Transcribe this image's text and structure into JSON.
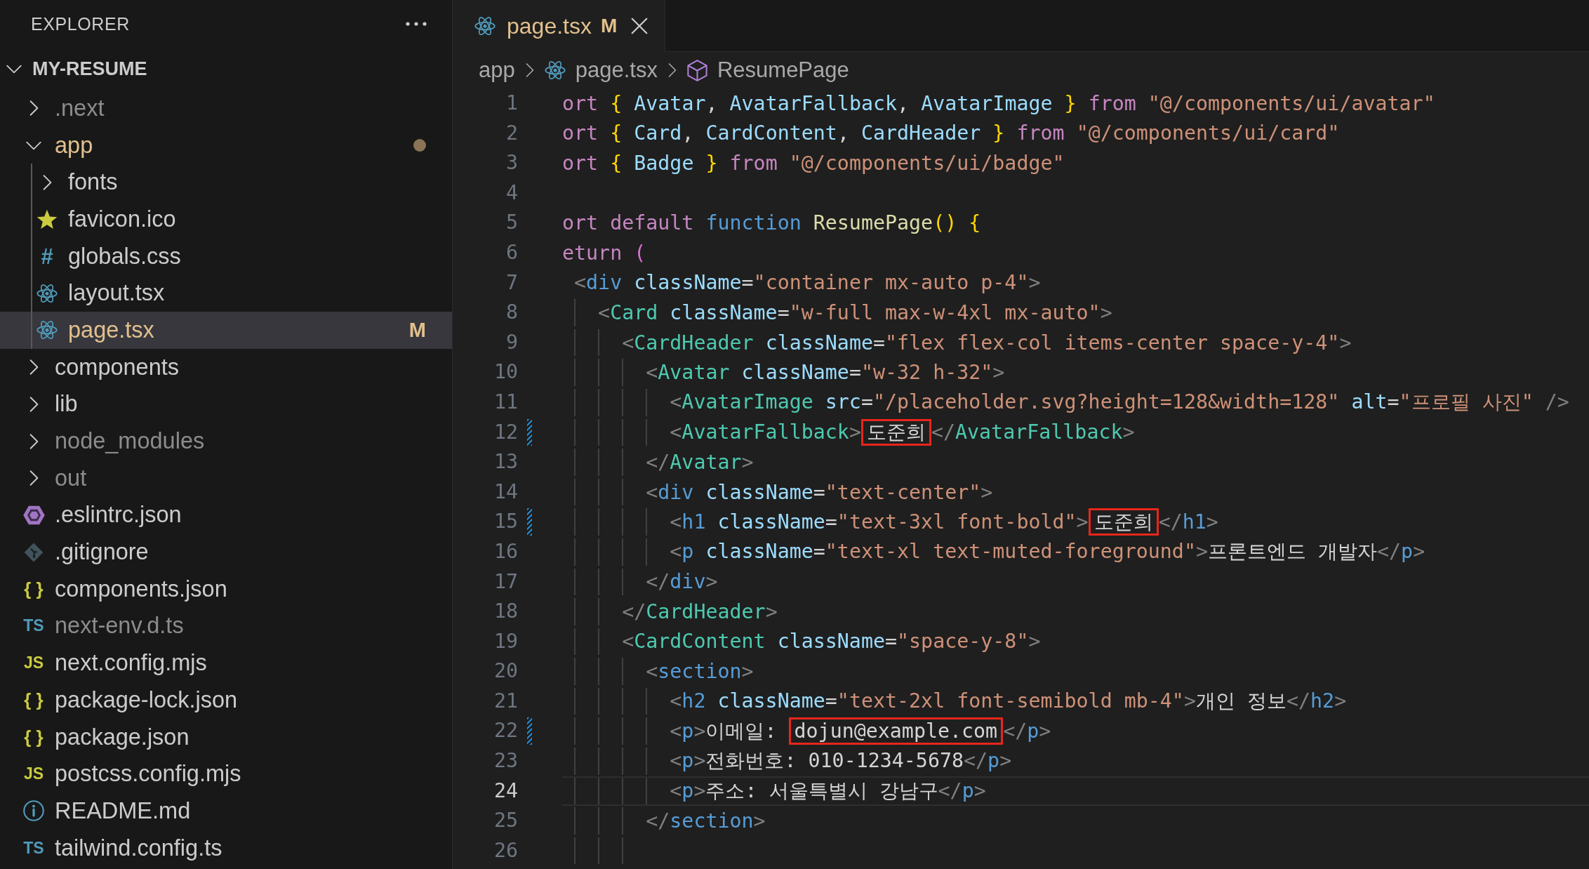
{
  "sidebar": {
    "title": "EXPLORER",
    "root": {
      "name": "MY-RESUME",
      "expanded": true,
      "children": [
        {
          "name": ".next",
          "kind": "folder",
          "expanded": false,
          "selected": false,
          "dimmed": true,
          "modified": false
        },
        {
          "name": "app",
          "kind": "folder",
          "expanded": true,
          "selected": false,
          "dimmed": false,
          "modified": true,
          "children": [
            {
              "name": "fonts",
              "kind": "folder",
              "expanded": false,
              "selected": false,
              "dimmed": false,
              "modified": false
            },
            {
              "name": "favicon.ico",
              "kind": "star",
              "selected": false,
              "dimmed": false,
              "modified": false
            },
            {
              "name": "globals.css",
              "kind": "css",
              "glyph": "#",
              "selected": false,
              "dimmed": false,
              "modified": false
            },
            {
              "name": "layout.tsx",
              "kind": "react",
              "selected": false,
              "dimmed": false,
              "modified": false
            },
            {
              "name": "page.tsx",
              "kind": "react",
              "badge": "M",
              "selected": true,
              "dimmed": false,
              "modified": true
            }
          ]
        },
        {
          "name": "components",
          "kind": "folder",
          "expanded": false,
          "selected": false,
          "dimmed": false,
          "modified": false
        },
        {
          "name": "lib",
          "kind": "folder",
          "expanded": false,
          "selected": false,
          "dimmed": false,
          "modified": false
        },
        {
          "name": "node_modules",
          "kind": "folder",
          "expanded": false,
          "selected": false,
          "dimmed": true,
          "modified": false
        },
        {
          "name": "out",
          "kind": "folder",
          "expanded": false,
          "selected": false,
          "dimmed": true,
          "modified": false
        },
        {
          "name": ".eslintrc.json",
          "kind": "eslint",
          "selected": false,
          "dimmed": false,
          "modified": false
        },
        {
          "name": ".gitignore",
          "kind": "git",
          "selected": false,
          "dimmed": false,
          "modified": false
        },
        {
          "name": "components.json",
          "kind": "json",
          "glyph": "{ }",
          "selected": false,
          "dimmed": false,
          "modified": false
        },
        {
          "name": "next-env.d.ts",
          "kind": "ts",
          "glyph": "TS",
          "selected": false,
          "dimmed": true,
          "modified": false
        },
        {
          "name": "next.config.mjs",
          "kind": "js",
          "glyph": "JS",
          "selected": false,
          "dimmed": false,
          "modified": false
        },
        {
          "name": "package-lock.json",
          "kind": "json",
          "glyph": "{ }",
          "selected": false,
          "dimmed": false,
          "modified": false
        },
        {
          "name": "package.json",
          "kind": "json",
          "glyph": "{ }",
          "selected": false,
          "dimmed": false,
          "modified": false
        },
        {
          "name": "postcss.config.mjs",
          "kind": "js",
          "glyph": "JS",
          "selected": false,
          "dimmed": false,
          "modified": false
        },
        {
          "name": "README.md",
          "kind": "info",
          "selected": false,
          "dimmed": false,
          "modified": false
        },
        {
          "name": "tailwind.config.ts",
          "kind": "ts",
          "glyph": "TS",
          "selected": false,
          "dimmed": false,
          "modified": false
        }
      ]
    }
  },
  "tabs": [
    {
      "label": "page.tsx",
      "kind": "react",
      "badge": "M",
      "modified": true,
      "selected": true
    }
  ],
  "breadcrumbs": [
    {
      "label": "app",
      "kind": "folder"
    },
    {
      "label": "page.tsx",
      "kind": "react"
    },
    {
      "label": "ResumePage",
      "kind": "symbol"
    }
  ],
  "editor": {
    "lines": [
      {
        "number": "1",
        "current": false,
        "modified": false,
        "tokens": [
          {
            "kind": "keyword",
            "text": "ort "
          },
          {
            "kind": "bracket",
            "text": "{ "
          },
          {
            "kind": "variable",
            "text": "Avatar"
          },
          {
            "kind": "plain",
            "text": ", "
          },
          {
            "kind": "variable",
            "text": "AvatarFallback"
          },
          {
            "kind": "plain",
            "text": ", "
          },
          {
            "kind": "variable",
            "text": "AvatarImage "
          },
          {
            "kind": "bracket",
            "text": "} "
          },
          {
            "kind": "keyword",
            "text": "from "
          },
          {
            "kind": "string",
            "text": "\"@/components/ui/avatar\""
          }
        ]
      },
      {
        "number": "2",
        "current": false,
        "modified": false,
        "tokens": [
          {
            "kind": "keyword",
            "text": "ort "
          },
          {
            "kind": "bracket",
            "text": "{ "
          },
          {
            "kind": "variable",
            "text": "Card"
          },
          {
            "kind": "plain",
            "text": ", "
          },
          {
            "kind": "variable",
            "text": "CardContent"
          },
          {
            "kind": "plain",
            "text": ", "
          },
          {
            "kind": "variable",
            "text": "CardHeader "
          },
          {
            "kind": "bracket",
            "text": "} "
          },
          {
            "kind": "keyword",
            "text": "from "
          },
          {
            "kind": "string",
            "text": "\"@/components/ui/card\""
          }
        ]
      },
      {
        "number": "3",
        "current": false,
        "modified": false,
        "tokens": [
          {
            "kind": "keyword",
            "text": "ort "
          },
          {
            "kind": "bracket",
            "text": "{ "
          },
          {
            "kind": "variable",
            "text": "Badge "
          },
          {
            "kind": "bracket",
            "text": "} "
          },
          {
            "kind": "keyword",
            "text": "from "
          },
          {
            "kind": "string",
            "text": "\"@/components/ui/badge\""
          }
        ]
      },
      {
        "number": "4",
        "current": false,
        "modified": false
      },
      {
        "number": "5",
        "current": false,
        "modified": false,
        "tokens": [
          {
            "kind": "keyword",
            "text": "ort default "
          },
          {
            "kind": "storage",
            "text": "function "
          },
          {
            "kind": "function",
            "text": "ResumePage"
          },
          {
            "kind": "bracket",
            "text": "() {"
          }
        ]
      },
      {
        "number": "6",
        "current": false,
        "modified": false,
        "tokens": [
          {
            "kind": "keyword",
            "text": "eturn "
          },
          {
            "kind": "bracket2",
            "text": "("
          }
        ]
      },
      {
        "number": "7",
        "current": false,
        "modified": false,
        "tokens": [
          {
            "kind": "punct",
            "text": " <"
          },
          {
            "kind": "tag",
            "text": "div "
          },
          {
            "kind": "attribute",
            "text": "className"
          },
          {
            "kind": "plain",
            "text": "="
          },
          {
            "kind": "string",
            "text": "\"container mx-auto p-4\""
          },
          {
            "kind": "punct",
            "text": ">"
          }
        ]
      },
      {
        "number": "8",
        "current": false,
        "modified": false,
        "tokens": [
          {
            "kind": "punct",
            "text": "   <"
          },
          {
            "kind": "component",
            "text": "Card "
          },
          {
            "kind": "attribute",
            "text": "className"
          },
          {
            "kind": "plain",
            "text": "="
          },
          {
            "kind": "string",
            "text": "\"w-full max-w-4xl mx-auto\""
          },
          {
            "kind": "punct",
            "text": ">"
          }
        ]
      },
      {
        "number": "9",
        "current": false,
        "modified": false,
        "tokens": [
          {
            "kind": "punct",
            "text": "     <"
          },
          {
            "kind": "component",
            "text": "CardHeader "
          },
          {
            "kind": "attribute",
            "text": "className"
          },
          {
            "kind": "plain",
            "text": "="
          },
          {
            "kind": "string",
            "text": "\"flex flex-col items-center space-y-4\""
          },
          {
            "kind": "punct",
            "text": ">"
          }
        ]
      },
      {
        "number": "10",
        "current": false,
        "modified": false,
        "tokens": [
          {
            "kind": "punct",
            "text": "       <"
          },
          {
            "kind": "component",
            "text": "Avatar "
          },
          {
            "kind": "attribute",
            "text": "className"
          },
          {
            "kind": "plain",
            "text": "="
          },
          {
            "kind": "string",
            "text": "\"w-32 h-32\""
          },
          {
            "kind": "punct",
            "text": ">"
          }
        ]
      },
      {
        "number": "11",
        "current": false,
        "modified": false,
        "tokens": [
          {
            "kind": "punct",
            "text": "         <"
          },
          {
            "kind": "component",
            "text": "AvatarImage "
          },
          {
            "kind": "attribute",
            "text": "src"
          },
          {
            "kind": "plain",
            "text": "="
          },
          {
            "kind": "string",
            "text": "\"/placeholder.svg?height=128&width=128\" "
          },
          {
            "kind": "attribute",
            "text": "alt"
          },
          {
            "kind": "plain",
            "text": "="
          },
          {
            "kind": "string",
            "text": "\"프로필 사진\" "
          },
          {
            "kind": "punct",
            "text": "/>"
          }
        ]
      },
      {
        "number": "12",
        "current": false,
        "modified": true,
        "tokens": [
          {
            "kind": "punct",
            "text": "         <"
          },
          {
            "kind": "component",
            "text": "AvatarFallback"
          },
          {
            "kind": "punct",
            "text": ">"
          },
          {
            "kind": "boxed",
            "text": "도준희"
          },
          {
            "kind": "punct",
            "text": "</"
          },
          {
            "kind": "component",
            "text": "AvatarFallback"
          },
          {
            "kind": "punct",
            "text": ">"
          }
        ]
      },
      {
        "number": "13",
        "current": false,
        "modified": false,
        "tokens": [
          {
            "kind": "punct",
            "text": "       </"
          },
          {
            "kind": "component",
            "text": "Avatar"
          },
          {
            "kind": "punct",
            "text": ">"
          }
        ]
      },
      {
        "number": "14",
        "current": false,
        "modified": false,
        "tokens": [
          {
            "kind": "punct",
            "text": "       <"
          },
          {
            "kind": "tag",
            "text": "div "
          },
          {
            "kind": "attribute",
            "text": "className"
          },
          {
            "kind": "plain",
            "text": "="
          },
          {
            "kind": "string",
            "text": "\"text-center\""
          },
          {
            "kind": "punct",
            "text": ">"
          }
        ]
      },
      {
        "number": "15",
        "current": false,
        "modified": true,
        "tokens": [
          {
            "kind": "punct",
            "text": "         <"
          },
          {
            "kind": "tag",
            "text": "h1 "
          },
          {
            "kind": "attribute",
            "text": "className"
          },
          {
            "kind": "plain",
            "text": "="
          },
          {
            "kind": "string",
            "text": "\"text-3xl font-bold\""
          },
          {
            "kind": "punct",
            "text": ">"
          },
          {
            "kind": "boxed",
            "text": "도준희"
          },
          {
            "kind": "punct",
            "text": "</"
          },
          {
            "kind": "tag",
            "text": "h1"
          },
          {
            "kind": "punct",
            "text": ">"
          }
        ]
      },
      {
        "number": "16",
        "current": false,
        "modified": false,
        "tokens": [
          {
            "kind": "punct",
            "text": "         <"
          },
          {
            "kind": "tag",
            "text": "p "
          },
          {
            "kind": "attribute",
            "text": "className"
          },
          {
            "kind": "plain",
            "text": "="
          },
          {
            "kind": "string",
            "text": "\"text-xl text-muted-foreground\""
          },
          {
            "kind": "punct",
            "text": ">"
          },
          {
            "kind": "plain",
            "text": "프론트엔드 개발자"
          },
          {
            "kind": "punct",
            "text": "</"
          },
          {
            "kind": "tag",
            "text": "p"
          },
          {
            "kind": "punct",
            "text": ">"
          }
        ]
      },
      {
        "number": "17",
        "current": false,
        "modified": false,
        "tokens": [
          {
            "kind": "punct",
            "text": "       </"
          },
          {
            "kind": "tag",
            "text": "div"
          },
          {
            "kind": "punct",
            "text": ">"
          }
        ]
      },
      {
        "number": "18",
        "current": false,
        "modified": false,
        "tokens": [
          {
            "kind": "punct",
            "text": "     </"
          },
          {
            "kind": "component",
            "text": "CardHeader"
          },
          {
            "kind": "punct",
            "text": ">"
          }
        ]
      },
      {
        "number": "19",
        "current": false,
        "modified": false,
        "tokens": [
          {
            "kind": "punct",
            "text": "     <"
          },
          {
            "kind": "component",
            "text": "CardContent "
          },
          {
            "kind": "attribute",
            "text": "className"
          },
          {
            "kind": "plain",
            "text": "="
          },
          {
            "kind": "string",
            "text": "\"space-y-8\""
          },
          {
            "kind": "punct",
            "text": ">"
          }
        ]
      },
      {
        "number": "20",
        "current": false,
        "modified": false,
        "tokens": [
          {
            "kind": "punct",
            "text": "       <"
          },
          {
            "kind": "tag",
            "text": "section"
          },
          {
            "kind": "punct",
            "text": ">"
          }
        ]
      },
      {
        "number": "21",
        "current": false,
        "modified": false,
        "tokens": [
          {
            "kind": "punct",
            "text": "         <"
          },
          {
            "kind": "tag",
            "text": "h2 "
          },
          {
            "kind": "attribute",
            "text": "className"
          },
          {
            "kind": "plain",
            "text": "="
          },
          {
            "kind": "string",
            "text": "\"text-2xl font-semibold mb-4\""
          },
          {
            "kind": "punct",
            "text": ">"
          },
          {
            "kind": "plain",
            "text": "개인 정보"
          },
          {
            "kind": "punct",
            "text": "</"
          },
          {
            "kind": "tag",
            "text": "h2"
          },
          {
            "kind": "punct",
            "text": ">"
          }
        ]
      },
      {
        "number": "22",
        "current": false,
        "modified": true,
        "tokens": [
          {
            "kind": "punct",
            "text": "         <"
          },
          {
            "kind": "tag",
            "text": "p"
          },
          {
            "kind": "punct",
            "text": ">"
          },
          {
            "kind": "plain",
            "text": "이메일: "
          },
          {
            "kind": "boxed",
            "text": "dojun@example.com"
          },
          {
            "kind": "punct",
            "text": "</"
          },
          {
            "kind": "tag",
            "text": "p"
          },
          {
            "kind": "punct",
            "text": ">"
          }
        ]
      },
      {
        "number": "23",
        "current": false,
        "modified": false,
        "tokens": [
          {
            "kind": "punct",
            "text": "         <"
          },
          {
            "kind": "tag",
            "text": "p"
          },
          {
            "kind": "punct",
            "text": ">"
          },
          {
            "kind": "plain",
            "text": "전화번호: 010-1234-5678"
          },
          {
            "kind": "punct",
            "text": "</"
          },
          {
            "kind": "tag",
            "text": "p"
          },
          {
            "kind": "punct",
            "text": ">"
          }
        ]
      },
      {
        "number": "24",
        "current": true,
        "modified": false,
        "tokens": [
          {
            "kind": "punct",
            "text": "         <"
          },
          {
            "kind": "tag",
            "text": "p"
          },
          {
            "kind": "punct",
            "text": ">"
          },
          {
            "kind": "plain",
            "text": "주소: 서울특별시 강남구"
          },
          {
            "kind": "punct",
            "text": "</"
          },
          {
            "kind": "tag",
            "text": "p"
          },
          {
            "kind": "punct",
            "text": ">"
          }
        ]
      },
      {
        "number": "25",
        "current": false,
        "modified": false,
        "tokens": [
          {
            "kind": "punct",
            "text": "       </"
          },
          {
            "kind": "tag",
            "text": "section"
          },
          {
            "kind": "punct",
            "text": ">"
          }
        ]
      },
      {
        "number": "26",
        "current": false,
        "modified": false
      }
    ]
  }
}
